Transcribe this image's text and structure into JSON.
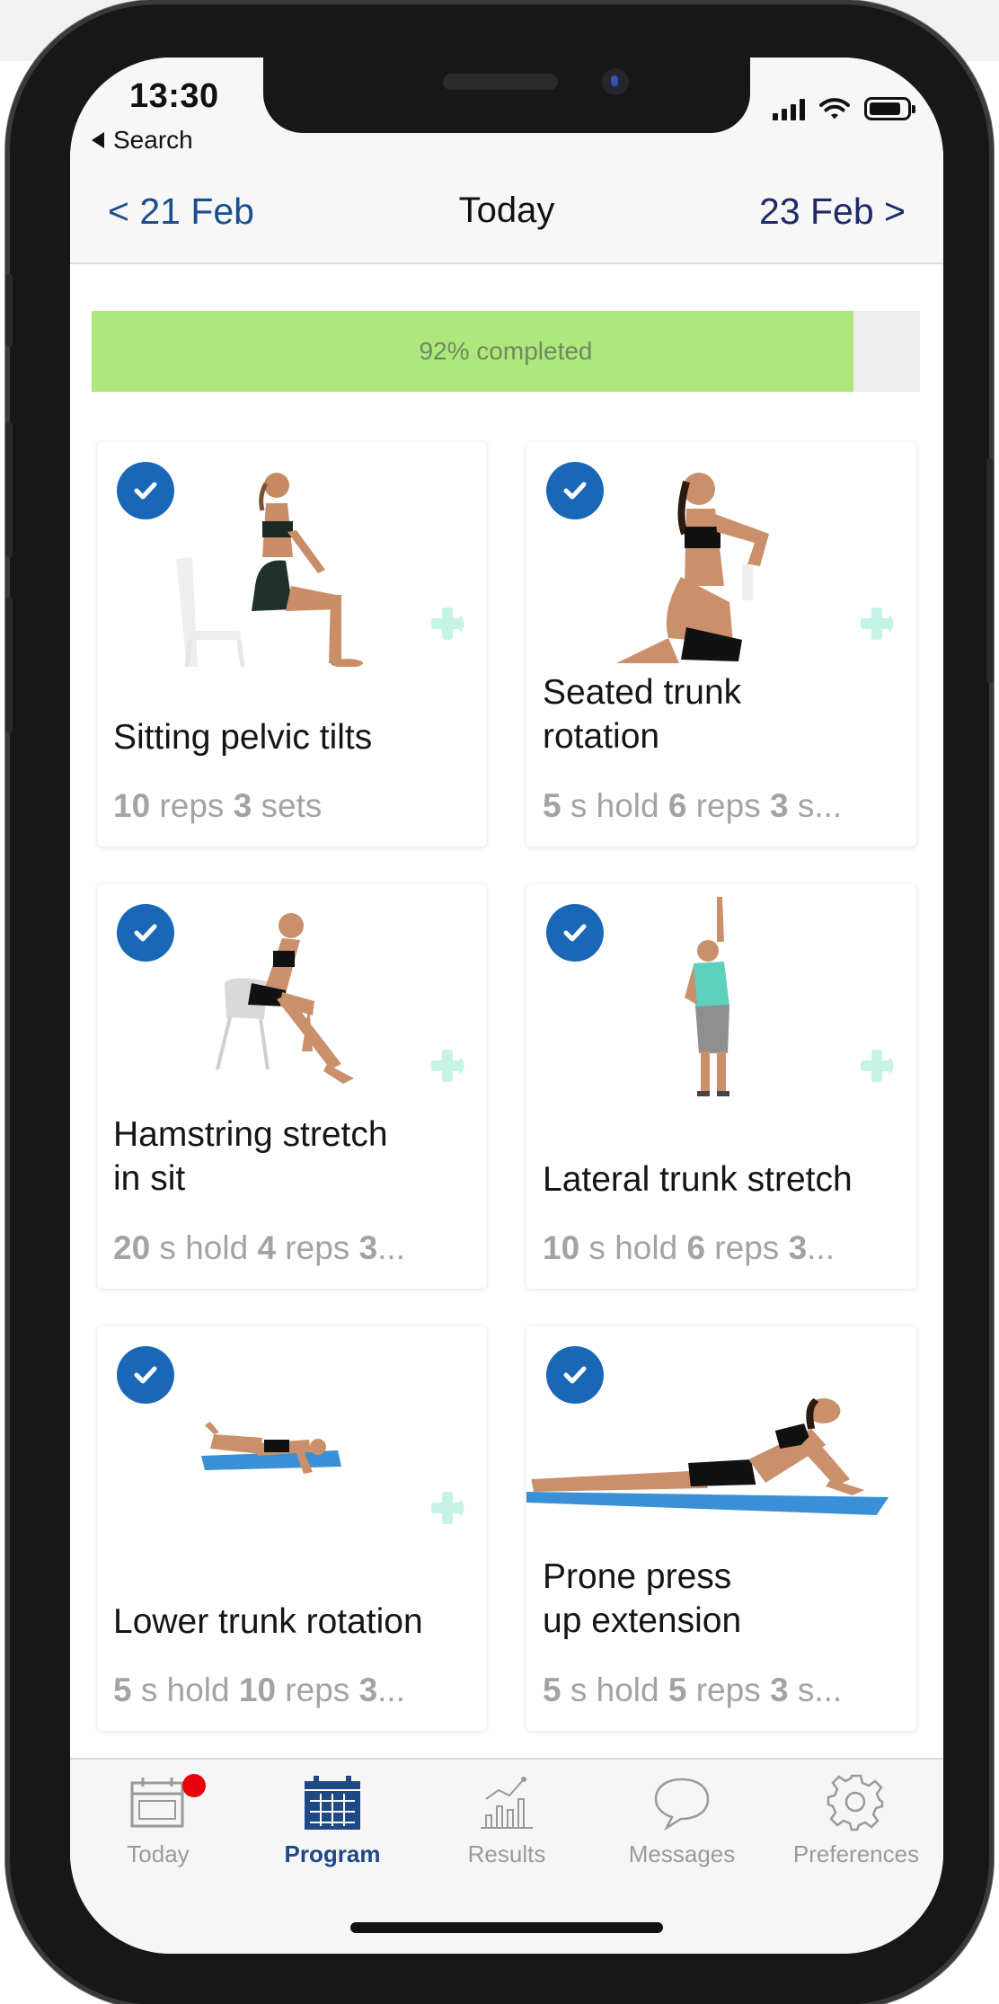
{
  "status_bar": {
    "time": "13:30",
    "back_label": "Search"
  },
  "date_nav": {
    "prev": "< 21 Feb",
    "title": "Today",
    "next": "23 Feb >"
  },
  "progress": {
    "label": "92% completed",
    "percent": 92,
    "color": "#aee87c"
  },
  "exercises": [
    {
      "title": "Sitting pelvic tilts",
      "meta": [
        [
          "10",
          " reps "
        ],
        [
          "3",
          " sets"
        ]
      ],
      "completed": true
    },
    {
      "title": "Seated trunk\nrotation",
      "meta": [
        [
          "5",
          " s hold "
        ],
        [
          "6",
          " reps "
        ],
        [
          "3",
          " s..."
        ]
      ],
      "completed": true
    },
    {
      "title": "Hamstring stretch\nin sit",
      "meta": [
        [
          "20",
          " s hold "
        ],
        [
          "4",
          " reps "
        ],
        [
          "3",
          "..."
        ]
      ],
      "completed": true
    },
    {
      "title": "Lateral trunk stretch",
      "meta": [
        [
          "10",
          " s hold "
        ],
        [
          "6",
          " reps "
        ],
        [
          "3",
          "..."
        ]
      ],
      "completed": true
    },
    {
      "title": "Lower trunk rotation",
      "meta": [
        [
          "5",
          " s hold "
        ],
        [
          "10",
          " reps "
        ],
        [
          "3",
          "..."
        ]
      ],
      "completed": true
    },
    {
      "title": "Prone press\nup extension",
      "meta": [
        [
          "5",
          " s hold "
        ],
        [
          "5",
          " reps "
        ],
        [
          "3",
          " s..."
        ]
      ],
      "completed": true
    }
  ],
  "tabs": [
    {
      "label": "Today",
      "icon": "calendar-outline-icon",
      "active": false,
      "has_badge": true
    },
    {
      "label": "Program",
      "icon": "calendar-grid-icon",
      "active": true,
      "has_badge": false
    },
    {
      "label": "Results",
      "icon": "chart-icon",
      "active": false,
      "has_badge": false
    },
    {
      "label": "Messages",
      "icon": "speech-bubble-icon",
      "active": false,
      "has_badge": false
    },
    {
      "label": "Preferences",
      "icon": "gear-icon",
      "active": false,
      "has_badge": false
    }
  ],
  "colors": {
    "accent": "#1967b6",
    "nav_blue": "#1a4f8d",
    "active_tab": "#1e4886",
    "badge": "#e8000c",
    "plus": "#c5f3e6"
  }
}
